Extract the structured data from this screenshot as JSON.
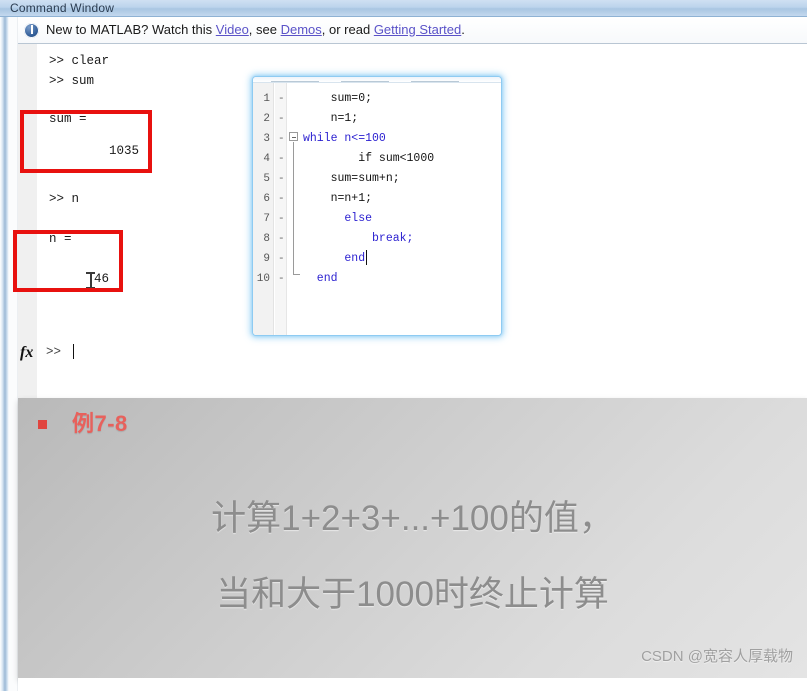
{
  "window": {
    "title": "Command Window"
  },
  "infobar": {
    "prefix": "New to MATLAB? Watch this ",
    "link1": "Video",
    "mid1": ", see ",
    "link2": "Demos",
    "mid2": ", or read ",
    "link3": "Getting Started",
    "suffix": ".",
    "icon": "info-icon"
  },
  "console": {
    "lines": [
      {
        "text": ">> clear"
      },
      {
        "text": ">> sum"
      },
      {
        "text": "sum ="
      },
      {
        "text": "        1035"
      },
      {
        "text": ">> n"
      },
      {
        "text": "n ="
      },
      {
        "text": "      46"
      }
    ],
    "prompt": ">>",
    "fx_label": "fx"
  },
  "annotations": {
    "box1_name": "sum-result-highlight",
    "box2_name": "n-result-highlight",
    "color": "#e8110f"
  },
  "editor": {
    "lines": [
      {
        "num": "1",
        "mark": "-",
        "code": "    sum=0;"
      },
      {
        "num": "2",
        "mark": "-",
        "code": "    n=1;"
      },
      {
        "num": "3",
        "mark": "-",
        "code": "while n<=100",
        "kw": "while"
      },
      {
        "num": "4",
        "mark": "-",
        "code": "        if sum<1000",
        "kw": "if"
      },
      {
        "num": "5",
        "mark": "-",
        "code": "    sum=sum+n;"
      },
      {
        "num": "6",
        "mark": "-",
        "code": "    n=n+1;"
      },
      {
        "num": "7",
        "mark": "-",
        "code": "      else",
        "kw": "else"
      },
      {
        "num": "8",
        "mark": "-",
        "code": "          break;",
        "kw": "break"
      },
      {
        "num": "9",
        "mark": "-",
        "code": "      end",
        "kw": "end"
      },
      {
        "num": "10",
        "mark": "-",
        "code": "  end",
        "kw": "end"
      }
    ]
  },
  "slide": {
    "heading": "例7-8",
    "line1": "计算1+2+3+...+100的值，",
    "line2": "当和大于1000时终止计算",
    "watermark": "CSDN @宽容人厚载物",
    "heading_color": "#e8615c"
  }
}
